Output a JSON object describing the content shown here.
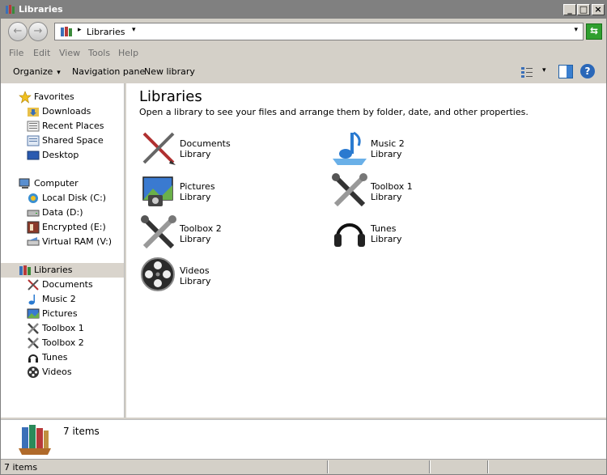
{
  "window": {
    "title": "Libraries",
    "minimize": "_",
    "maximize": "□",
    "close": "×"
  },
  "address": {
    "back": "←",
    "forward": "→",
    "separator": "▸",
    "crumb": "Libraries",
    "crumb_arrow": "▾",
    "dropdown": "▾",
    "refresh": "⇆"
  },
  "menu": [
    "File",
    "Edit",
    "View",
    "Tools",
    "Help"
  ],
  "toolbar": {
    "organize": "Organize",
    "organize_caret": "▾",
    "navigation_pane": "Navigation pane",
    "new_library": "New library",
    "view_caret": "▾",
    "help": "?"
  },
  "navpane": {
    "favorites_header": "Favorites",
    "favorites": [
      "Downloads",
      "Recent Places",
      "Shared Space",
      "Desktop"
    ],
    "computer_header": "Computer",
    "drives": [
      "Local Disk (C:)",
      "Data (D:)",
      "Encrypted (E:)",
      "Virtual RAM (V:)"
    ],
    "libraries_header": "Libraries",
    "libraries": [
      "Documents",
      "Music 2",
      "Pictures",
      "Toolbox 1",
      "Toolbox 2",
      "Tunes",
      "Videos"
    ]
  },
  "content": {
    "heading": "Libraries",
    "subtitle": "Open a library to see your files and arrange them by folder, date, and other properties.",
    "tiles": [
      {
        "name": "Documents",
        "type": "Library",
        "icon": "documents-icon"
      },
      {
        "name": "Music 2",
        "type": "Library",
        "icon": "music-icon"
      },
      {
        "name": "Pictures",
        "type": "Library",
        "icon": "pictures-icon"
      },
      {
        "name": "Toolbox 1",
        "type": "Library",
        "icon": "toolbox-icon"
      },
      {
        "name": "Toolbox 2",
        "type": "Library",
        "icon": "toolbox-icon"
      },
      {
        "name": "Tunes",
        "type": "Library",
        "icon": "headphones-icon"
      },
      {
        "name": "Videos",
        "type": "Library",
        "icon": "film-reel-icon"
      }
    ]
  },
  "details": {
    "count": "7  items"
  },
  "status": {
    "text": "7 items"
  }
}
